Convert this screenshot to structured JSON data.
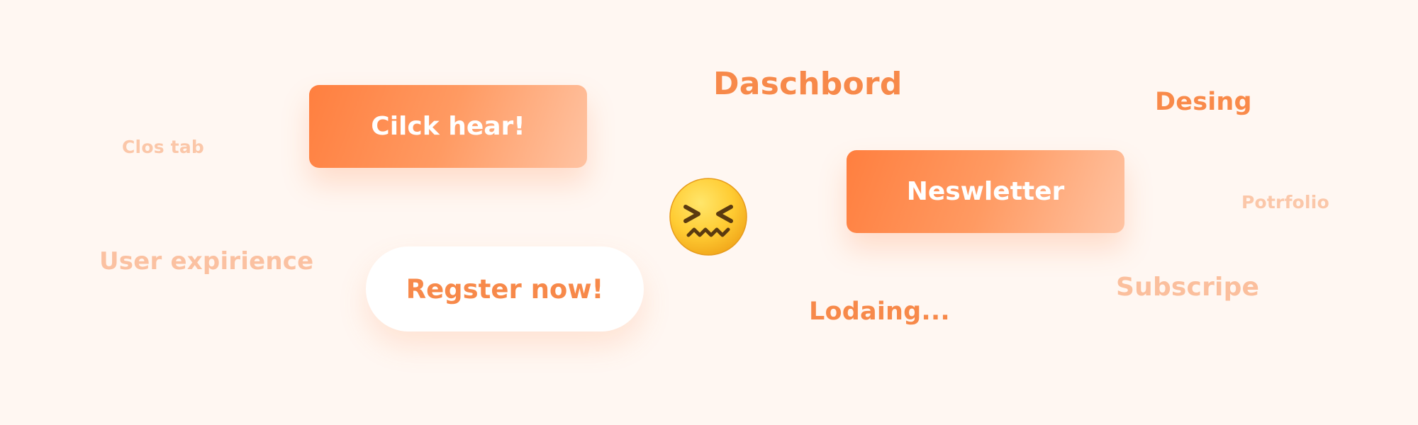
{
  "colors": {
    "background": "#fff7f2",
    "accent": "#f98a4a",
    "accent_light": "#ffc3a2",
    "faded": "#fbc7a9"
  },
  "buttons": {
    "click_here": "Cilck hear!",
    "newsletter": "Neswletter",
    "register_now": "Regster now!"
  },
  "labels": {
    "dashboard": "Daschbord",
    "design": "Desing",
    "close_tab": "Clos tab",
    "portfolio": "Potrfolio",
    "user_experience": "User expirience",
    "subscribe": "Subscripe",
    "loading": "Lodaing..."
  },
  "emoji": {
    "icon": "confounded-face-icon"
  }
}
